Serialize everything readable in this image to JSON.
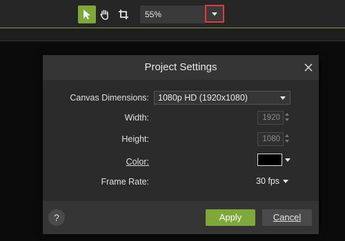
{
  "toolbar": {
    "tools": [
      {
        "name": "pointer",
        "icon": "arrow-pointer-icon",
        "active": true
      },
      {
        "name": "pan",
        "icon": "hand-icon",
        "active": false
      },
      {
        "name": "crop",
        "icon": "crop-icon",
        "active": false
      }
    ],
    "zoom_value": "55%"
  },
  "dialog": {
    "title": "Project Settings",
    "fields": {
      "canvas_label": "Canvas Dimensions:",
      "canvas_value": "1080p HD (1920x1080)",
      "width_label": "Width:",
      "width_value": "1920",
      "height_label": "Height:",
      "height_value": "1080",
      "color_label": "Color:",
      "color_value": "#000000",
      "frame_rate_label": "Frame Rate:",
      "frame_rate_value": "30 fps"
    },
    "help_label": "?",
    "apply_label": "Apply",
    "cancel_label": "Cancel"
  },
  "colors": {
    "accent_green": "#7ea83a",
    "highlight_red": "#e23b3b",
    "dialog_bg": "#2b2b2b",
    "header_bg": "#353535"
  }
}
